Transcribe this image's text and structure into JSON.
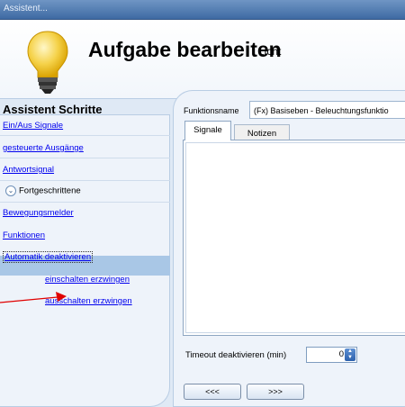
{
  "window": {
    "title": "Assistent..."
  },
  "header": {
    "title": "Aufgabe bearbeiten",
    "subtitle": "Licht",
    "icon": "light-bulb-icon"
  },
  "sidebar": {
    "title": "Assistent Schritte",
    "items": [
      {
        "label": "Ein/Aus Signale"
      },
      {
        "label": "gesteuerte Ausgänge"
      },
      {
        "label": "Antwortsignal"
      }
    ],
    "advanced": {
      "label": "Fortgeschrittene",
      "icon": "chevron-down-icon"
    },
    "advanced_items": [
      {
        "label": "Bewegungsmelder"
      },
      {
        "label": "Funktionen"
      },
      {
        "label": "Automatik deaktivieren",
        "active": true
      },
      {
        "label": "einschalten erzwingen"
      },
      {
        "label": "ausschalten erzwingen"
      }
    ]
  },
  "main": {
    "function_name_label": "Funktionsname",
    "function_name_value": "(Fx) Basiseben - Beleuchtungsfunktio",
    "tabs": [
      {
        "label": "Signale"
      },
      {
        "label": "Notizen"
      }
    ],
    "timeout_label": "Timeout deaktivieren (min)",
    "timeout_value": "0",
    "prev_button": "<<<",
    "next_button": ">>>"
  },
  "colors": {
    "link": "#0000ee",
    "active_row": "#a9c7e6",
    "annotation_arrow": "#e00000"
  }
}
